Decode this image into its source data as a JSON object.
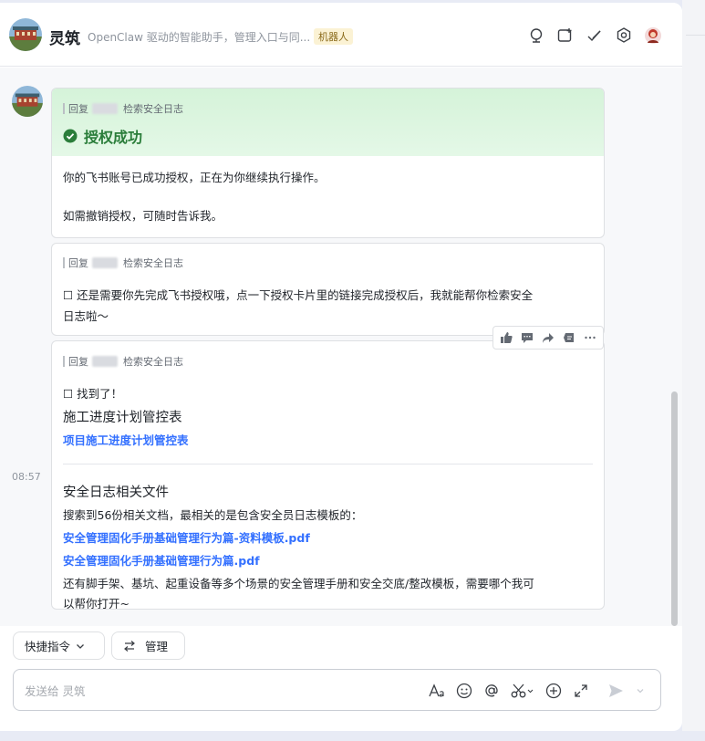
{
  "header": {
    "title": "灵筑",
    "subtitle": "OpenClaw 驱动的智能助手，管理入口与同...",
    "badge": "机器人"
  },
  "chat": {
    "time": "08:57",
    "reply_prefix": "回复",
    "reply_subject": "检索安全日志",
    "card1": {
      "title": "授权成功",
      "line1": "你的飞书账号已成功授权，正在为你继续执行操作。",
      "line2": "如需撤销授权，可随时告诉我。"
    },
    "card2": {
      "line1": "☐ 还是需要你先完成飞书授权哦，点一下授权卡片里的链接完成授权后，我就能帮你检索安全",
      "line2": "日志啦～"
    },
    "card3": {
      "found": "☐ 找到了！",
      "section1_title": "施工进度计划管控表",
      "section1_link": "项目施工进度计划管控表",
      "section2_title": "安全日志相关文件",
      "section2_desc": "搜索到56份相关文档，最相关的是包含安全员日志模板的：",
      "link1": "安全管理固化手册基础管理行为篇-资料模板.pdf",
      "link2": "安全管理固化手册基础管理行为篇.pdf",
      "footer1": "还有脚手架、基坑、起重设备等多个场景的安全管理手册和安全交底/整改模板，需要哪个我可",
      "footer2": "以帮你打开~"
    }
  },
  "bottom": {
    "quick_label": "快捷指令",
    "manage_label": "管理",
    "placeholder": "发送给 灵筑"
  },
  "colors": {
    "link": "#3370ff",
    "success": "#2a7d3a"
  }
}
